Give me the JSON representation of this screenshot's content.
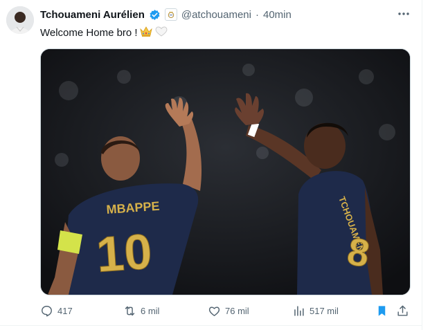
{
  "tweet": {
    "author_name": "Tchouameni Aurélien",
    "handle": "@atchouameni",
    "separator": "·",
    "time": "40min",
    "text": "Welcome Home bro !",
    "emojis": [
      "crown-emoji",
      "white-heart-emoji"
    ],
    "media": {
      "left_jersey_name": "MBAPPE",
      "left_jersey_number": "10",
      "right_jersey_name": "TCHOUAMENI",
      "right_jersey_number": "8"
    }
  },
  "actions": {
    "replies": "417",
    "reposts": "6 mil",
    "likes": "76 mil",
    "views": "517 mil"
  },
  "colors": {
    "accent": "#1d9bf0",
    "muted": "#536471",
    "bookmark": "#1d9bf0",
    "jersey": "#1e2a4a",
    "jersey_text": "#d6b14a"
  }
}
